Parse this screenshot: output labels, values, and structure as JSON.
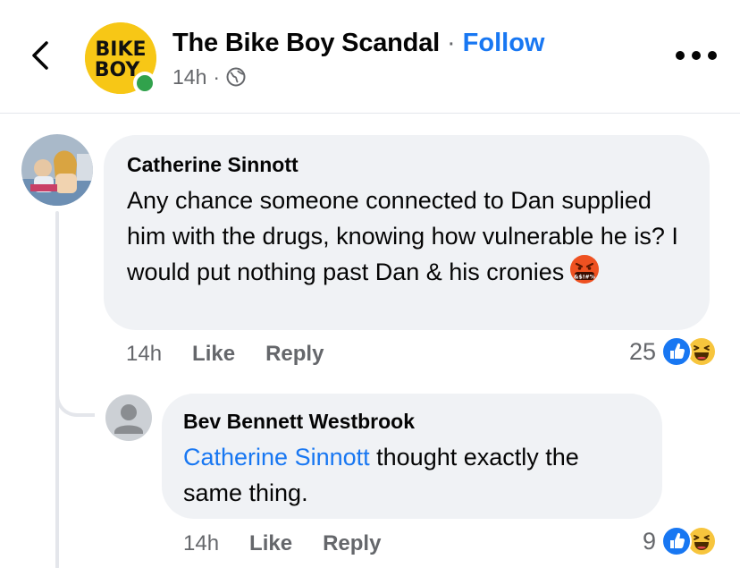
{
  "header": {
    "page_name": "The Bike Boy Scandal",
    "separator": "·",
    "follow_label": "Follow",
    "time": "14h",
    "meta_separator": "·",
    "logo_line1": "BIKE",
    "logo_line2": "BOY",
    "logo_color": "#f7c716",
    "online_color": "#31a24c"
  },
  "comments": [
    {
      "author": "Catherine Sinnott",
      "text": "Any chance someone connected to Dan supplied him with the drugs, knowing how vulnerable he is? I would put nothing past Dan & his cronies",
      "emoji": "face-with-symbols-on-mouth",
      "time": "14h",
      "like_label": "Like",
      "reply_label": "Reply",
      "reaction_count": "25",
      "reactions": [
        "like",
        "haha"
      ]
    },
    {
      "author": "Bev Bennett Westbrook",
      "mention": "Catherine Sinnott",
      "text": " thought exactly the same thing.",
      "time": "14h",
      "like_label": "Like",
      "reply_label": "Reply",
      "reaction_count": "9",
      "reactions": [
        "like",
        "haha"
      ]
    }
  ],
  "colors": {
    "link": "#1877f2",
    "bubble": "#f0f2f5",
    "secondary_text": "#65676b"
  }
}
